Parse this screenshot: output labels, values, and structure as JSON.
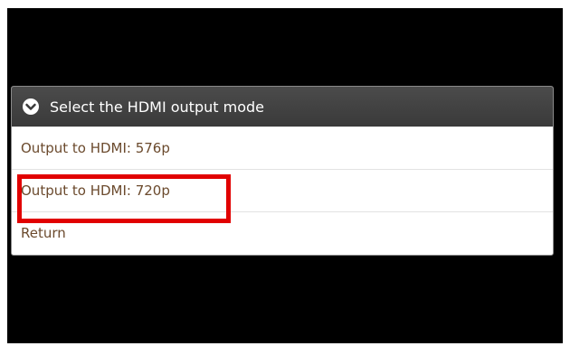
{
  "dialog": {
    "title": "Select the HDMI output mode",
    "icon": "chevron-down-circle-icon",
    "options": [
      {
        "label": "Output to HDMI: 576p"
      },
      {
        "label": "Output to HDMI: 720p"
      },
      {
        "label": "Return"
      }
    ]
  },
  "annotation": {
    "highlighted_option": "Output to HDMI: 720p",
    "color": "#e10000"
  },
  "colors": {
    "screen_background": "#000000",
    "header_background": "#444444",
    "option_text": "#6b4a2d"
  }
}
